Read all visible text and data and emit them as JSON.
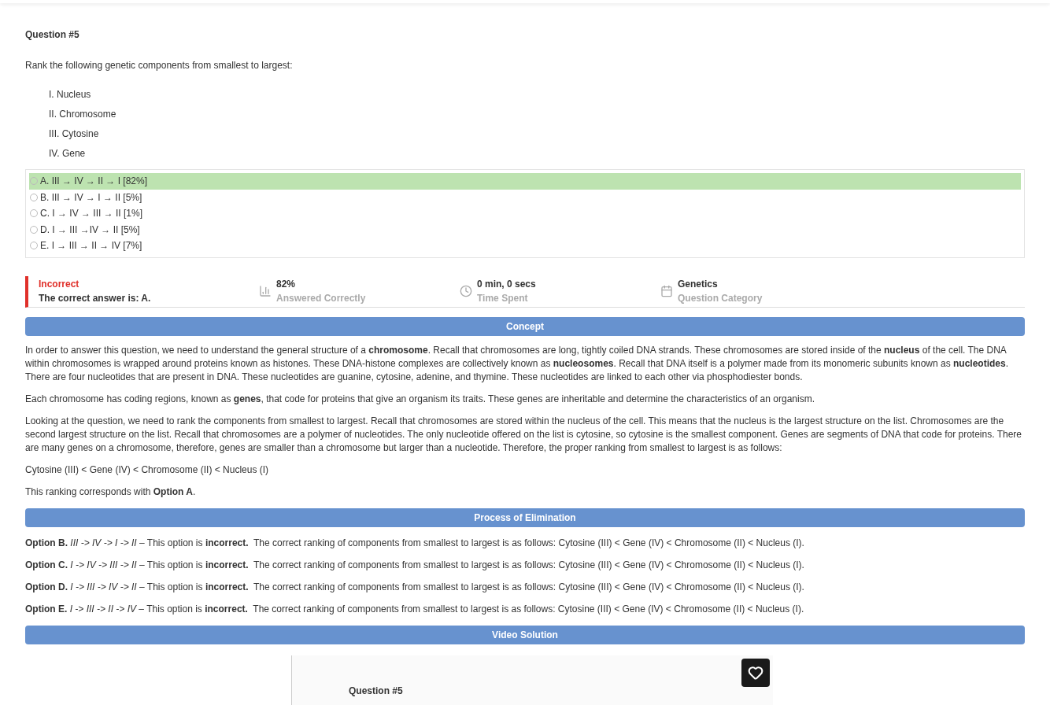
{
  "question": {
    "title": "Question #5",
    "prompt": "Rank the following genetic components from smallest to largest:",
    "items": [
      "I. Nucleus",
      "II. Chromosome",
      "III. Cytosine",
      "IV. Gene"
    ]
  },
  "choices": [
    {
      "label": "A. III → IV → II → I [82%]",
      "correct": true
    },
    {
      "label": "B. III → IV → I → II [5%]",
      "correct": false
    },
    {
      "label": "C. I → IV → III → II [1%]",
      "correct": false
    },
    {
      "label": "D. I → III →IV → II [5%]",
      "correct": false
    },
    {
      "label": "E. I → III → II → IV [7%]",
      "correct": false
    }
  ],
  "result": {
    "status": "Incorrect",
    "answer": "The correct answer is: A.",
    "stats": [
      {
        "kind": "chart",
        "value": "82%",
        "label": "Answered Correctly"
      },
      {
        "kind": "clock",
        "value": "0 min, 0 secs",
        "label": "Time Spent"
      },
      {
        "kind": "calendar",
        "value": "Genetics",
        "label": "Question Category"
      }
    ]
  },
  "concept": {
    "heading": "Concept",
    "paragraphs": [
      "In order to answer this question, we need to understand the general structure of a **chromosome**. Recall that chromosomes are long, tightly coiled DNA strands. These chromosomes are stored inside of the **nucleus** of the cell. The DNA within chromosomes is wrapped around proteins known as histones. These DNA-histone complexes are collectively known as **nucleosomes**. Recall that DNA itself is a polymer made from its monomeric subunits known as **nucleotides**. There are four nucleotides that are present in DNA. These nucleotides are guanine, cytosine, adenine, and thymine. These nucleotides are linked to each other via phosphodiester bonds.",
      "Each chromosome has coding regions, known as **genes**, that code for proteins that give an organism its traits. These genes are inheritable and determine the characteristics of an organism.",
      "Looking at the question, we need to rank the components from smallest to largest. Recall that chromosomes are stored within the nucleus of the cell. This means that the nucleus is the largest structure on the list. Chromosomes are the second largest structure on the list. Recall that chromosomes are a polymer of nucleotides. The only nucleotide offered on the list is cytosine, so cytosine is the smallest component. Genes are segments of DNA that code for proteins. There are many genes on a chromosome, therefore, genes are smaller than a chromosome but larger than a nucleotide. Therefore, the proper ranking from smallest to largest is as follows:",
      "Cytosine (III) < Gene (IV) < Chromosome (II) < Nucleus (I)",
      "This ranking corresponds with **Option A**."
    ]
  },
  "elimination": {
    "heading": "Process of Elimination",
    "paragraphs": [
      "**Option B.** *III -> IV -> I -> II* – This option is **incorrect.**  The correct ranking of components from smallest to largest is as follows: Cytosine (III) < Gene (IV) < Chromosome (II) < Nucleus (I).",
      "**Option C.** *I -> IV -> III -> II* – This option is **incorrect.**  The correct ranking of components from smallest to largest is as follows: Cytosine (III) < Gene (IV) < Chromosome (II) < Nucleus (I).",
      "**Option D.** *I -> III -> IV -> II* – This option is **incorrect.**  The correct ranking of components from smallest to largest is as follows: Cytosine (III) < Gene (IV) < Chromosome (II) < Nucleus (I).",
      "**Option E.** *I -> III -> II -> IV* – This option is **incorrect.**  The correct ranking of components from smallest to largest is as follows: Cytosine (III) < Gene (IV) < Chromosome (II) < Nucleus (I)."
    ]
  },
  "video": {
    "heading": "Video Solution",
    "title": "Question #5"
  }
}
